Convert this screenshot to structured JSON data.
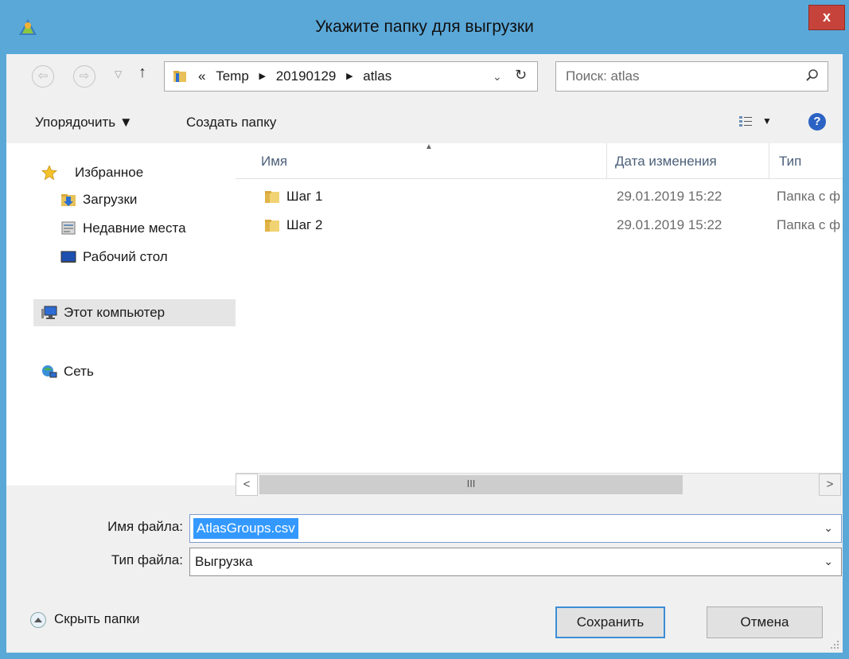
{
  "window": {
    "title": "Укажите папку для выгрузки",
    "close_label": "x"
  },
  "address_bar": {
    "overflow": "«",
    "crumbs": [
      "Temp",
      "20190129",
      "atlas"
    ]
  },
  "search": {
    "placeholder": "Поиск: atlas"
  },
  "toolbar": {
    "organize_label": "Упорядочить ▼",
    "new_folder_label": "Создать папку",
    "help_label": "?"
  },
  "nav_pane": {
    "favorites": "Избранное",
    "downloads": "Загрузки",
    "recent": "Недавние места",
    "desktop": "Рабочий стол",
    "this_pc": "Этот компьютер",
    "network": "Сеть"
  },
  "file_list": {
    "columns": [
      "Имя",
      "Дата изменения",
      "Тип"
    ],
    "rows": [
      {
        "name": "Шаг 1",
        "date": "29.01.2019 15:22",
        "type": "Папка с ф"
      },
      {
        "name": "Шаг 2",
        "date": "29.01.2019 15:22",
        "type": "Папка с ф"
      }
    ]
  },
  "scrollbar": {
    "left": "<",
    "thumb": "III",
    "right": ">"
  },
  "fields": {
    "filename_label": "Имя файла:",
    "filename_value": "AtlasGroups.csv",
    "filetype_label": "Тип файла:",
    "filetype_value": "Выгрузка"
  },
  "footer": {
    "hide_folders_label": "Скрыть папки",
    "save_label": "Сохранить",
    "cancel_label": "Отмена"
  },
  "colors": {
    "titlebar": "#5aa8d8",
    "close_button": "#c6433b",
    "selection": "#3399ff",
    "header_text": "#4c607a"
  }
}
